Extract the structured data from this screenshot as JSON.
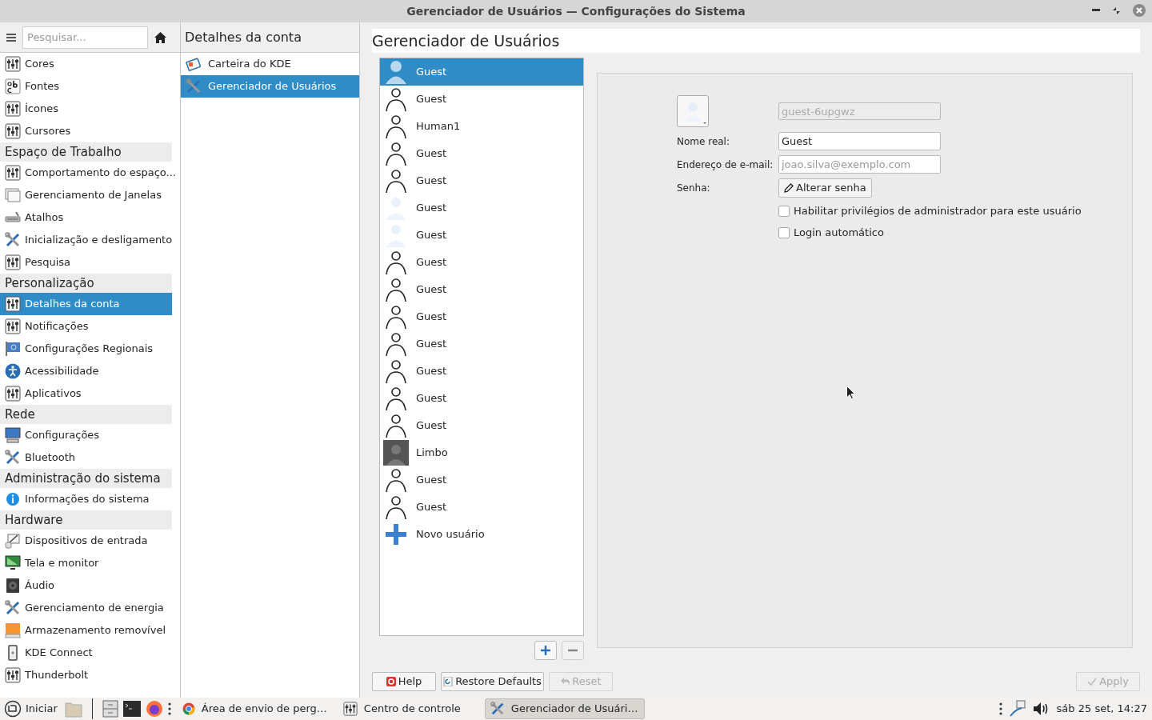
{
  "window": {
    "title": "Gerenciador de Usuários — Configurações do Sistema"
  },
  "sidebar": {
    "search": {
      "placeholder": "Pesquisar..."
    },
    "items": [
      {
        "kind": "module",
        "label": "Cores",
        "selected": false
      },
      {
        "kind": "module",
        "label": "Fontes",
        "selected": false
      },
      {
        "kind": "module",
        "label": "Ícones",
        "selected": false
      },
      {
        "kind": "module",
        "label": "Cursores",
        "selected": false
      },
      {
        "kind": "category",
        "label": "Espaço de Trabalho"
      },
      {
        "kind": "module",
        "label": "Comportamento do espaço...",
        "selected": false
      },
      {
        "kind": "module",
        "label": "Gerenciamento de Janelas",
        "selected": false
      },
      {
        "kind": "module",
        "label": "Atalhos",
        "selected": false
      },
      {
        "kind": "module",
        "label": "Inicialização e desligamento",
        "selected": false
      },
      {
        "kind": "module",
        "label": "Pesquisa",
        "selected": false
      },
      {
        "kind": "category",
        "label": "Personalização"
      },
      {
        "kind": "module",
        "label": "Detalhes da conta",
        "selected": true
      },
      {
        "kind": "module",
        "label": "Notificações",
        "selected": false
      },
      {
        "kind": "module",
        "label": "Configurações Regionais",
        "selected": false
      },
      {
        "kind": "module",
        "label": "Acessibilidade",
        "selected": false
      },
      {
        "kind": "module",
        "label": "Aplicativos",
        "selected": false
      },
      {
        "kind": "category",
        "label": "Rede"
      },
      {
        "kind": "module",
        "label": "Configurações",
        "selected": false
      },
      {
        "kind": "module",
        "label": "Bluetooth",
        "selected": false
      },
      {
        "kind": "category",
        "label": "Administração do sistema"
      },
      {
        "kind": "module",
        "label": "Informações do sistema",
        "selected": false
      },
      {
        "kind": "category",
        "label": "Hardware"
      },
      {
        "kind": "module",
        "label": "Dispositivos de entrada",
        "selected": false
      },
      {
        "kind": "module",
        "label": "Tela e monitor",
        "selected": false
      },
      {
        "kind": "module",
        "label": "Áudio",
        "selected": false
      },
      {
        "kind": "module",
        "label": "Gerenciamento de energia",
        "selected": false
      },
      {
        "kind": "module",
        "label": "Armazenamento removível",
        "selected": false
      },
      {
        "kind": "module",
        "label": "KDE Connect",
        "selected": false
      },
      {
        "kind": "module",
        "label": "Thunderbolt",
        "selected": false
      }
    ]
  },
  "subpanel": {
    "title": "Detalhes da conta",
    "items": [
      {
        "label": "Carteira do KDE",
        "selected": false
      },
      {
        "label": "Gerenciador de Usuários",
        "selected": true
      }
    ]
  },
  "page": {
    "title": "Gerenciador de Usuários",
    "users": [
      {
        "kind": "solid",
        "name": "Guest",
        "selected": true
      },
      {
        "kind": "outline",
        "name": "Guest",
        "selected": false
      },
      {
        "kind": "outline",
        "name": "Human1",
        "selected": false
      },
      {
        "kind": "outline",
        "name": "Guest",
        "selected": false
      },
      {
        "kind": "outline",
        "name": "Guest",
        "selected": false
      },
      {
        "kind": "faded",
        "name": "Guest",
        "selected": false
      },
      {
        "kind": "faded",
        "name": "Guest",
        "selected": false
      },
      {
        "kind": "outline",
        "name": "Guest",
        "selected": false
      },
      {
        "kind": "outline",
        "name": "Guest",
        "selected": false
      },
      {
        "kind": "outline",
        "name": "Guest",
        "selected": false
      },
      {
        "kind": "outline",
        "name": "Guest",
        "selected": false
      },
      {
        "kind": "outline",
        "name": "Guest",
        "selected": false
      },
      {
        "kind": "outline",
        "name": "Guest",
        "selected": false
      },
      {
        "kind": "outline",
        "name": "Guest",
        "selected": false
      },
      {
        "kind": "photo",
        "name": "Limbo",
        "selected": false
      },
      {
        "kind": "outline",
        "name": "Guest",
        "selected": false
      },
      {
        "kind": "outline",
        "name": "Guest",
        "selected": false
      },
      {
        "kind": "add",
        "name": "Novo usuário",
        "selected": false
      }
    ],
    "form": {
      "username": {
        "value": "guest-6upgwz",
        "disabled": true
      },
      "fields": [
        {
          "label": "Nome real:",
          "value": "Guest"
        },
        {
          "label": "Endereço de e-mail:",
          "placeholder": "joao.silva@exemplo.com"
        }
      ],
      "password": {
        "label": "Senha:",
        "button": "Alterar senha"
      },
      "checkboxes": [
        {
          "label": "Habilitar privilégios de administrador para este usuário",
          "checked": false
        },
        {
          "label": "Login automático",
          "checked": false
        }
      ]
    },
    "buttons": [
      {
        "label": "Help",
        "disabled": false
      },
      {
        "label": "Restore Defaults",
        "disabled": false
      },
      {
        "label": "Reset",
        "disabled": true
      },
      {
        "label": "Apply",
        "disabled": true
      }
    ]
  },
  "taskbar": {
    "start": "Iniciar",
    "tasks": [
      {
        "label": "Área de envio de perg…",
        "selected": false
      },
      {
        "label": "Centro de controle",
        "selected": false
      },
      {
        "label": "Gerenciador de Usuári…",
        "selected": true
      }
    ],
    "clock": "sáb 25 set, 14:27"
  }
}
